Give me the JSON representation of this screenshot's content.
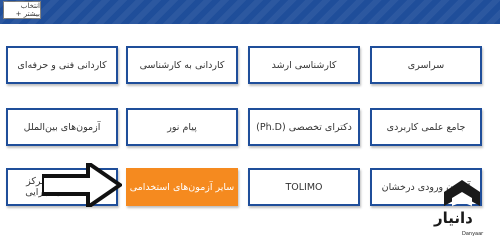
{
  "header": {
    "tab_label": "انتخاب بیشتر +"
  },
  "tiles": {
    "r1c1": "سراسری",
    "r1c2": "کارشناسی ارشد",
    "r1c3": "کاردانی به کارشناسی",
    "r1c4": "کاردانی فنی و حرفه‌ای",
    "r2c1": "جامع علمی کاربردی",
    "r2c2": "دکترای تخصصی (Ph.D)",
    "r2c3": "پیام نور",
    "r2c4": "آزمون‌های بین‌الملل",
    "r3c1": "آزمون ورودی درخشان",
    "r3c2": "TOLIMO",
    "r3c3": "سایر آزمون‌های استخدامی",
    "r3c4": "استخدامی متمرکز دستگاه‌های اجرایی"
  },
  "colors": {
    "brand_blue": "#1f4e9a",
    "accent_orange": "#f58a1f"
  },
  "logo": {
    "name": "دانیار",
    "sub": "Danyaar"
  }
}
